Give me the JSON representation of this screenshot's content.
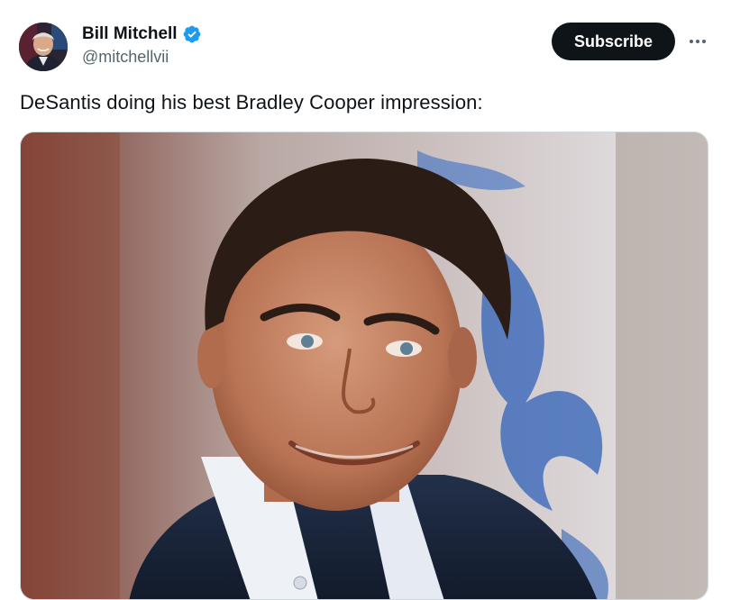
{
  "author": {
    "display_name": "Bill Mitchell",
    "handle": "@mitchellvii",
    "verified": true,
    "verified_color": "#1d9bf0",
    "avatar_icon": "profile-photo"
  },
  "actions": {
    "subscribe_label": "Subscribe",
    "more_icon": "ellipsis-icon"
  },
  "tweet": {
    "text": "DeSantis doing his best Bradley Cooper impression:"
  },
  "media": {
    "kind": "photo",
    "subject": "portrait-photo"
  },
  "colors": {
    "button_bg": "#0f1419",
    "text_primary": "#0f1419",
    "text_secondary": "#536471"
  }
}
